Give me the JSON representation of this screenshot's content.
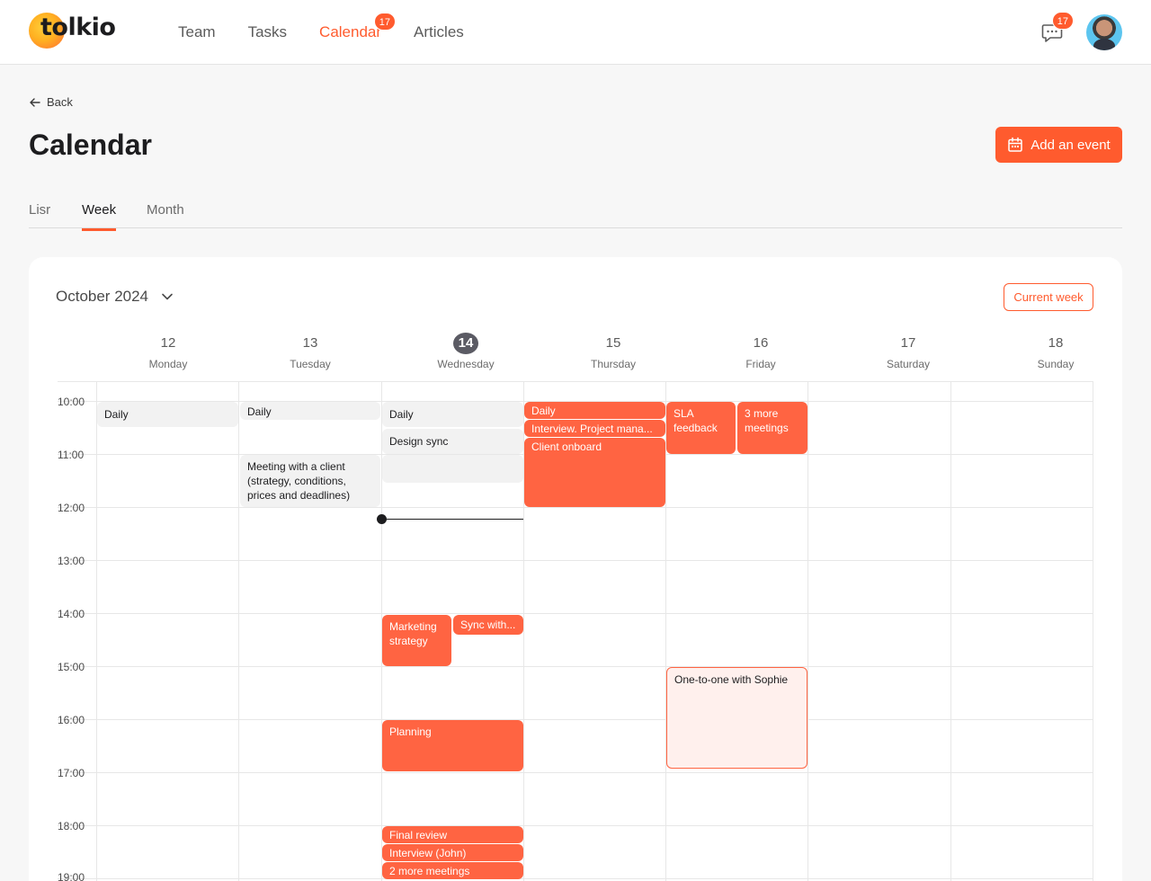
{
  "header": {
    "logo_text": "tolkio",
    "nav": [
      {
        "label": "Team"
      },
      {
        "label": "Tasks"
      },
      {
        "label": "Calendar",
        "badge": "17"
      },
      {
        "label": "Articles"
      }
    ],
    "chat_badge": "17",
    "colors": {
      "accent": "#ff5b2e"
    }
  },
  "page": {
    "back_label": "Back",
    "title": "Calendar",
    "add_button": "Add an event",
    "tabs": [
      "Lisr",
      "Week",
      "Month"
    ],
    "active_tab": "Week"
  },
  "calendar": {
    "month_label": "October 2024",
    "current_week_button": "Current week",
    "days": [
      {
        "num": "12",
        "name": "Monday"
      },
      {
        "num": "13",
        "name": "Tuesday"
      },
      {
        "num": "14",
        "name": "Wednesday",
        "today": true
      },
      {
        "num": "15",
        "name": "Thursday"
      },
      {
        "num": "16",
        "name": "Friday"
      },
      {
        "num": "17",
        "name": "Saturday"
      },
      {
        "num": "18",
        "name": "Sunday"
      }
    ],
    "hours": [
      "10:00",
      "11:00",
      "12:00",
      "13:00",
      "14:00",
      "15:00",
      "16:00",
      "17:00",
      "18:00",
      "19:00"
    ],
    "events": [
      {
        "day": "Monday",
        "title": "Daily",
        "time": "10:00",
        "style": "gray"
      },
      {
        "day": "Tuesday",
        "title": "Daily",
        "time": "10:00",
        "style": "gray"
      },
      {
        "day": "Tuesday",
        "title": "Meeting with a client (strategy, conditions, prices and deadlines)",
        "time": "11:00",
        "style": "gray"
      },
      {
        "day": "Wednesday",
        "title": "Daily",
        "time": "10:00",
        "style": "gray"
      },
      {
        "day": "Wednesday",
        "title": "Design sync",
        "time": "10:30",
        "style": "gray"
      },
      {
        "day": "Wednesday",
        "title": "",
        "time": "11:00",
        "style": "gray"
      },
      {
        "day": "Wednesday",
        "title": "Marketing strategy",
        "time": "14:00",
        "style": "orange"
      },
      {
        "day": "Wednesday",
        "title": "Sync with...",
        "time": "14:00",
        "style": "orange"
      },
      {
        "day": "Wednesday",
        "title": "Planning",
        "time": "16:00",
        "style": "orange"
      },
      {
        "day": "Wednesday",
        "title": "Final review",
        "time": "18:00",
        "style": "orange"
      },
      {
        "day": "Wednesday",
        "title": "Interview (John)",
        "time": "18:20",
        "style": "orange"
      },
      {
        "day": "Wednesday",
        "title": "2 more meetings",
        "time": "18:40",
        "style": "orange"
      },
      {
        "day": "Thursday",
        "title": "Daily",
        "time": "10:00",
        "style": "orange"
      },
      {
        "day": "Thursday",
        "title": "Interview. Project mana...",
        "time": "10:20",
        "style": "orange"
      },
      {
        "day": "Thursday",
        "title": "Client onboard",
        "time": "10:40",
        "style": "orange"
      },
      {
        "day": "Friday",
        "title": "SLA feedback",
        "time": "10:00",
        "style": "orange"
      },
      {
        "day": "Friday",
        "title": "3 more meetings",
        "time": "10:00",
        "style": "orange"
      },
      {
        "day": "Friday",
        "title": "One-to-one with Sophie",
        "time": "15:00",
        "style": "pink"
      }
    ]
  }
}
